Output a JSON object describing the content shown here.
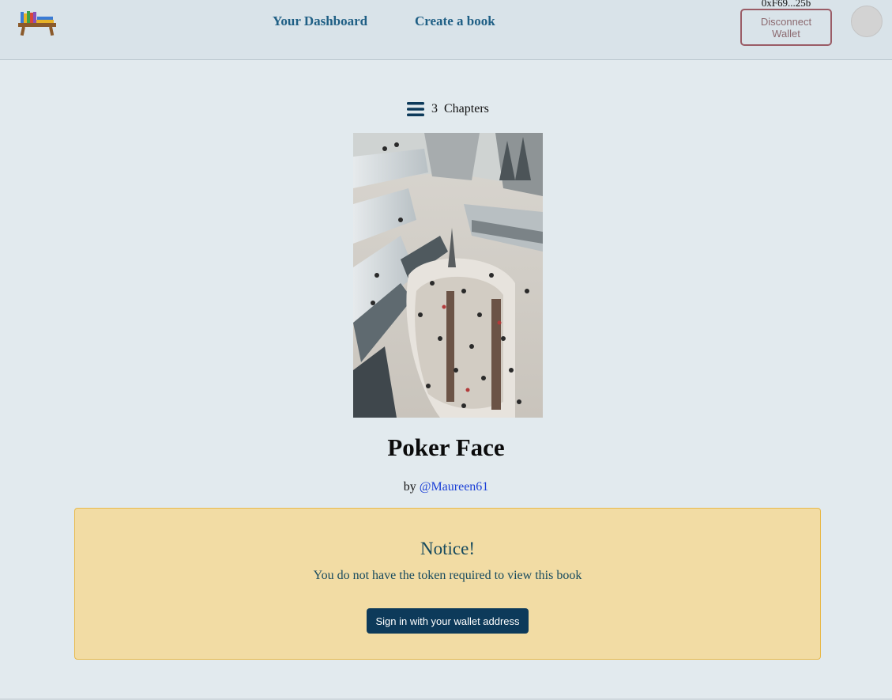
{
  "nav": {
    "dashboard_label": "Your Dashboard",
    "create_label": "Create a book",
    "wallet_address": "0xF69...25b",
    "disconnect_label": "Disconnect Wallet"
  },
  "book": {
    "chapter_count": "3",
    "chapters_label": "Chapters",
    "title": "Poker Face",
    "by_label": "by",
    "author": "@Maureen61"
  },
  "notice": {
    "title": "Notice!",
    "message": "You do not have the token required to view this book",
    "button_label": "Sign in with your wallet address"
  },
  "icons": {
    "logo": "bookshelf-logo-icon",
    "chapters": "hamburger-menu-icon"
  },
  "colors": {
    "nav_link": "#1f5f85",
    "notice_bg": "#f2dca4",
    "notice_border": "#e8b94a",
    "button_bg": "#0d3a5a",
    "author_link": "#1a3fd6"
  }
}
